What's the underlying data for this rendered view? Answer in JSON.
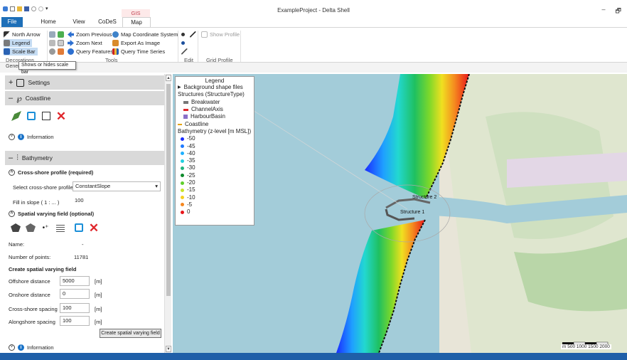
{
  "app": {
    "title": "ExampleProject - Delta Shell"
  },
  "window_controls": {
    "minimize": "–",
    "restore": "🗗"
  },
  "tabs": {
    "file": "File",
    "home": "Home",
    "view": "View",
    "codes": "CoDeS",
    "context_group": "GIS",
    "map": "Map"
  },
  "ribbon": {
    "north_arrow": "North Arrow",
    "legend": "Legend",
    "scale_bar": "Scale Bar",
    "decorations_group": "Decorations",
    "zoom_previous": "Zoom Previous",
    "zoom_next": "Zoom Next",
    "query_features": "Query Features",
    "map_coordinate_system": "Map Coordinate System",
    "export_as_image": "Export As Image",
    "query_time_series": "Query Time Series",
    "tools_group": "Tools",
    "edit_group": "Edit",
    "show_profile": "Show Profile",
    "grid_profile_group": "Grid Profile"
  },
  "tooltip": {
    "text": "Shows or hides scale bar"
  },
  "panel_tab": {
    "label": "General info"
  },
  "panel": {
    "settings_title": "Settings",
    "coastline_title": "Coastline",
    "information": "Information",
    "bathymetry_title": "Bathymetry",
    "cross_shore_title": "Cross-shore profile (required)",
    "select_profile_label": "Select cross-shore profile",
    "select_profile_value": "ConstantSlope",
    "fill_slope_label": "Fill in slope ( 1 : ... )",
    "fill_slope_value": "100",
    "spatial_title": "Spatial varying field (optional)",
    "name_label": "Name:",
    "name_value": "-",
    "points_label": "Number of points:",
    "points_value": "11781",
    "create_title": "Create spatial varying field",
    "offshore_label": "Offshore distance",
    "offshore_value": "5000",
    "onshore_label": "Onshore distance",
    "onshore_value": "0",
    "cross_spacing_label": "Cross-shore spacing",
    "cross_spacing_value": "100",
    "along_spacing_label": "Alongshore spacing",
    "along_spacing_value": "100",
    "unit_m": "[m]",
    "create_button": "Create spatial varying field",
    "information2": "Information"
  },
  "legend": {
    "title": "Legend",
    "background": "Background shape files",
    "structures": "Structures (StructureType)",
    "breakwater": "Breakwater",
    "channel_axis": "ChannelAxis",
    "harbour_basin": "HarbourBasin",
    "coastline": "Coastline",
    "bathy_title": "Bathymetry (z-level [m MSL])",
    "levels": [
      {
        "label": "-50",
        "color": "#1a2cff"
      },
      {
        "label": "-45",
        "color": "#1e7aff"
      },
      {
        "label": "-40",
        "color": "#1fb0ff"
      },
      {
        "label": "-35",
        "color": "#22cfe0"
      },
      {
        "label": "-30",
        "color": "#1fb37e"
      },
      {
        "label": "-25",
        "color": "#0e8a2c"
      },
      {
        "label": "-20",
        "color": "#5fcf2c"
      },
      {
        "label": "-15",
        "color": "#c7e42a"
      },
      {
        "label": "-10",
        "color": "#f5d01f"
      },
      {
        "label": "-5",
        "color": "#f5871f"
      },
      {
        "label": "0",
        "color": "#e8151a"
      }
    ]
  },
  "map": {
    "structure1": "Structure 1",
    "structure2": "Structure 2",
    "scale_labels": "m  500 1000 1500 2000"
  }
}
